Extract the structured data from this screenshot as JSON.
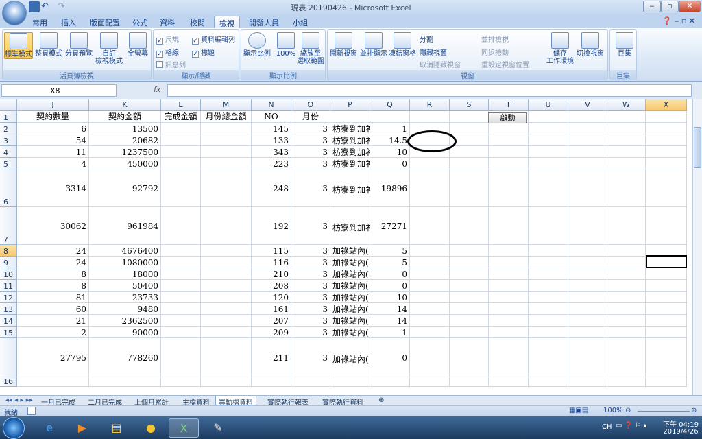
{
  "window": {
    "title": "現表 20190426 - Microsoft Excel",
    "min": "‒",
    "max": "▫",
    "close": "✕"
  },
  "ribbon_tabs": [
    "常用",
    "插入",
    "版面配置",
    "公式",
    "資料",
    "校閱",
    "檢視",
    "開發人員",
    "小組"
  ],
  "active_tab": "檢視",
  "ribbon": {
    "views": {
      "label": "活頁簿檢視",
      "normal": "標準模式",
      "page_layout": "整頁模式",
      "page_break": "分頁預覽",
      "custom": "自訂\n檢視模式",
      "fullscreen": "全螢幕"
    },
    "show": {
      "label": "顯示/隱藏",
      "ruler": "尺規",
      "formula_bar": "資料編輯列",
      "gridlines": "格線",
      "headings": "標題",
      "message_bar": "訊息列"
    },
    "zoom": {
      "label": "顯示比例",
      "zoom": "顯示比例",
      "zoom100": "100%",
      "zoom_sel": "縮放至\n選取範圍"
    },
    "window": {
      "label": "視窗",
      "new": "開新視窗",
      "arrange": "並排顯示",
      "freeze": "凍結窗格",
      "split": "分割",
      "hide": "隱藏視窗",
      "unhide": "取消隱藏視窗",
      "side": "並排檢視",
      "sync": "同步捲動",
      "reset": "重設定視窗位置",
      "save_ws": "儲存\n工作環境",
      "switch": "切換視窗"
    },
    "macros": {
      "label": "巨集",
      "macros": "巨集"
    }
  },
  "formula": {
    "namebox": "X8",
    "fx": "fx",
    "value": ""
  },
  "columns": [
    "J",
    "K",
    "L",
    "M",
    "N",
    "O",
    "P",
    "Q",
    "R",
    "S",
    "T",
    "U",
    "V",
    "W",
    "X"
  ],
  "selected_col": "X",
  "rows": [
    {
      "n": "1",
      "J": "契約數量",
      "K": "契約金額",
      "L": "完成金額",
      "M": "月份總金額",
      "N": "NO",
      "O": "月份",
      "P": "",
      "Q": ""
    },
    {
      "n": "2",
      "J": "6",
      "K": "13500",
      "N": "145",
      "O": "3",
      "P": "枋寮到加衤",
      "Q": "1"
    },
    {
      "n": "3",
      "J": "54",
      "K": "20682",
      "N": "133",
      "O": "3",
      "P": "枋寮到加衤",
      "Q": "14.5"
    },
    {
      "n": "4",
      "J": "11",
      "K": "1237500",
      "N": "343",
      "O": "3",
      "P": "枋寮到加衤",
      "Q": "10"
    },
    {
      "n": "5",
      "J": "4",
      "K": "450000",
      "N": "223",
      "O": "3",
      "P": "枋寮到加衤",
      "Q": "0"
    },
    {
      "n": "6",
      "J": "3314",
      "K": "92792",
      "N": "248",
      "O": "3",
      "P": "枋寮到加衤",
      "Q": "19896"
    },
    {
      "n": "7",
      "J": "30062",
      "K": "961984",
      "N": "192",
      "O": "3",
      "P": "枋寮到加衤",
      "Q": "27271"
    },
    {
      "n": "8",
      "J": "24",
      "K": "4676400",
      "N": "115",
      "O": "3",
      "P": "加祿站內(",
      "Q": "5"
    },
    {
      "n": "9",
      "J": "24",
      "K": "1080000",
      "N": "116",
      "O": "3",
      "P": "加祿站內(",
      "Q": "5"
    },
    {
      "n": "10",
      "J": "8",
      "K": "18000",
      "N": "210",
      "O": "3",
      "P": "加祿站內(",
      "Q": "0"
    },
    {
      "n": "11",
      "J": "8",
      "K": "50400",
      "N": "208",
      "O": "3",
      "P": "加祿站內(",
      "Q": "0"
    },
    {
      "n": "12",
      "J": "81",
      "K": "23733",
      "N": "120",
      "O": "3",
      "P": "加祿站內(",
      "Q": "10"
    },
    {
      "n": "13",
      "J": "60",
      "K": "9480",
      "N": "161",
      "O": "3",
      "P": "加祿站內(",
      "Q": "14"
    },
    {
      "n": "14",
      "J": "21",
      "K": "2362500",
      "N": "207",
      "O": "3",
      "P": "加祿站內(",
      "Q": "14"
    },
    {
      "n": "15",
      "J": "2",
      "K": "90000",
      "N": "209",
      "O": "3",
      "P": "加祿站內(",
      "Q": "1"
    },
    {
      "n": "",
      "J": "27795",
      "K": "778260",
      "N": "211",
      "O": "3",
      "P": "加祿站內(",
      "Q": "0"
    },
    {
      "n": "16",
      "J": "",
      "K": "",
      "N": "",
      "O": "",
      "P": "",
      "Q": ""
    }
  ],
  "start_button": "啟動",
  "sheet_tabs": [
    "一月已完成",
    "二月已完成",
    "上個月累計",
    "主檔資料",
    "異動檔資料",
    "實際執行報表",
    "實際執行資料"
  ],
  "active_sheet": "異動檔資料",
  "status": {
    "ready": "就緒",
    "zoom": "100%"
  },
  "tray": {
    "lang": "CH",
    "time": "下午 04:19",
    "date": "2019/4/26"
  }
}
